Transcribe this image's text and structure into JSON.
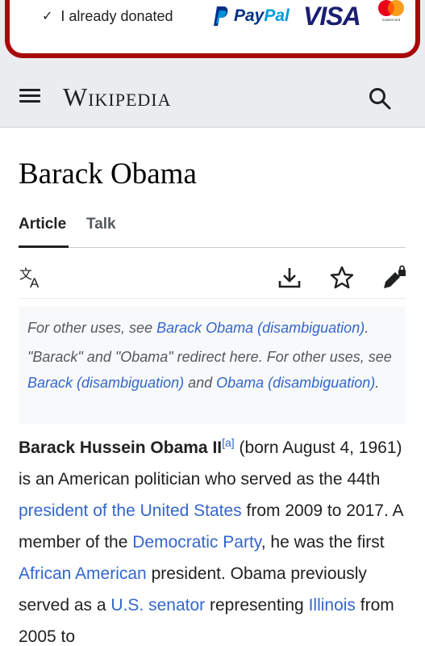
{
  "banner": {
    "check": "✓",
    "donated_label": "I already donated",
    "paypal_part1": "Pay",
    "paypal_part2": "Pal",
    "visa": "VISA",
    "mastercard_text": "mastercard",
    "border_color": "#a8080a"
  },
  "header": {
    "logo": "Wikipedia",
    "menu_icon": "hamburger-menu-icon",
    "search_icon": "search-icon"
  },
  "article": {
    "title": "Barack Obama",
    "tabs": [
      {
        "label": "Article",
        "selected": true
      },
      {
        "label": "Talk",
        "selected": false
      }
    ],
    "actions": [
      "language-icon",
      "download-icon",
      "watch-star-icon",
      "edit-locked-icon"
    ],
    "hatnote": {
      "line1_prefix": "For other uses, see ",
      "line1_link": "Barack Obama (disambiguation)",
      "line1_suffix": ".",
      "line2_prefix": "\"Barack\" and \"Obama\" redirect here. For other uses, see ",
      "line2_link1": "Barack (disambiguation)",
      "line2_mid": " and ",
      "line2_link2": "Obama (disambiguation)",
      "line2_suffix": "."
    },
    "lead": {
      "name": "Barack Hussein Obama II",
      "ref": "[a]",
      "t1": " (born August 4, 1961) is an American politician who served as the 44th ",
      "l1": "president of the United States",
      "t2": " from 2009 to 2017. A member of the ",
      "l2": "Democratic Party",
      "t3": ", he was the first ",
      "l3": "African American",
      "t4": " president. Obama previously served as a ",
      "l4": "U.S. senator",
      "t5": " representing ",
      "l5": "Illinois",
      "t6": " from 2005 to"
    }
  },
  "colors": {
    "link": "#3366cc",
    "header_bg": "#eaecf0",
    "text": "#202122"
  }
}
